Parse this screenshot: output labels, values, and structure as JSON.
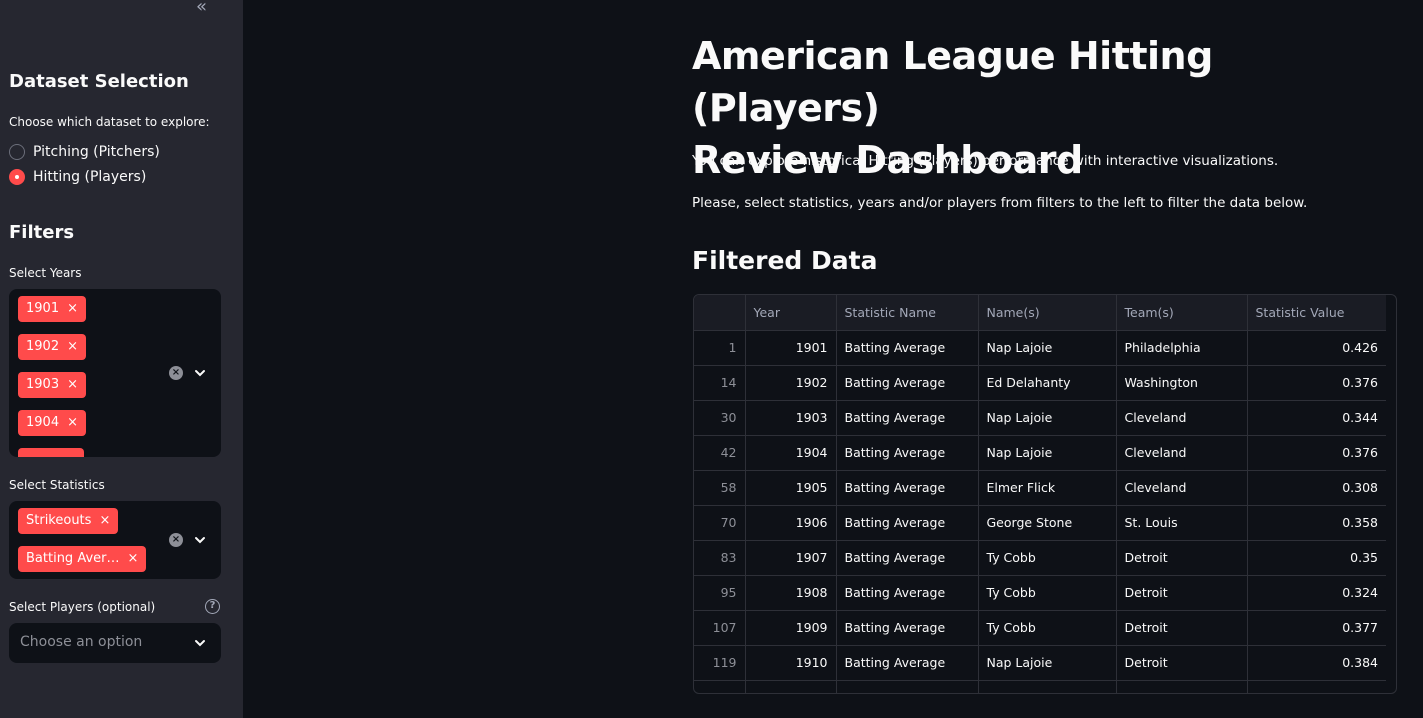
{
  "sidebar": {
    "collapse_glyph": "«",
    "dataset_heading": "Dataset Selection",
    "dataset_prompt": "Choose which dataset to explore:",
    "dataset_options": [
      {
        "label": "Pitching (Pitchers)",
        "selected": false
      },
      {
        "label": "Hitting (Players)",
        "selected": true
      }
    ],
    "filters_heading": "Filters",
    "years_label": "Select Years",
    "years_selected": [
      "1901",
      "1902",
      "1903",
      "1904"
    ],
    "statistics_label": "Select Statistics",
    "statistics_selected": [
      "Strikeouts",
      "Batting Aver…"
    ],
    "players_label": "Select Players (optional)",
    "players_placeholder": "Choose an option",
    "tag_remove_glyph": "×",
    "help_glyph": "?",
    "accent_color": "#ff4b4b"
  },
  "main": {
    "title_line1": "American League Hitting (Players)",
    "title_line2": "Review Dashboard",
    "intro": "You can explore historical Hitting (Players) performance with interactive visualizations.",
    "instructions": "Please, select statistics, years and/or players from filters to the left to filter the data below.",
    "table_heading": "Filtered Data",
    "table": {
      "columns": [
        "",
        "Year",
        "Statistic Name",
        "Name(s)",
        "Team(s)",
        "Statistic Value"
      ],
      "rows": [
        [
          "1",
          "1901",
          "Batting Average",
          "Nap Lajoie",
          "Philadelphia",
          "0.426"
        ],
        [
          "14",
          "1902",
          "Batting Average",
          "Ed Delahanty",
          "Washington",
          "0.376"
        ],
        [
          "30",
          "1903",
          "Batting Average",
          "Nap Lajoie",
          "Cleveland",
          "0.344"
        ],
        [
          "42",
          "1904",
          "Batting Average",
          "Nap Lajoie",
          "Cleveland",
          "0.376"
        ],
        [
          "58",
          "1905",
          "Batting Average",
          "Elmer Flick",
          "Cleveland",
          "0.308"
        ],
        [
          "70",
          "1906",
          "Batting Average",
          "George Stone",
          "St. Louis",
          "0.358"
        ],
        [
          "83",
          "1907",
          "Batting Average",
          "Ty Cobb",
          "Detroit",
          "0.35"
        ],
        [
          "95",
          "1908",
          "Batting Average",
          "Ty Cobb",
          "Detroit",
          "0.324"
        ],
        [
          "107",
          "1909",
          "Batting Average",
          "Ty Cobb",
          "Detroit",
          "0.377"
        ],
        [
          "119",
          "1910",
          "Batting Average",
          "Nap Lajoie",
          "Detroit",
          "0.384"
        ]
      ]
    }
  }
}
